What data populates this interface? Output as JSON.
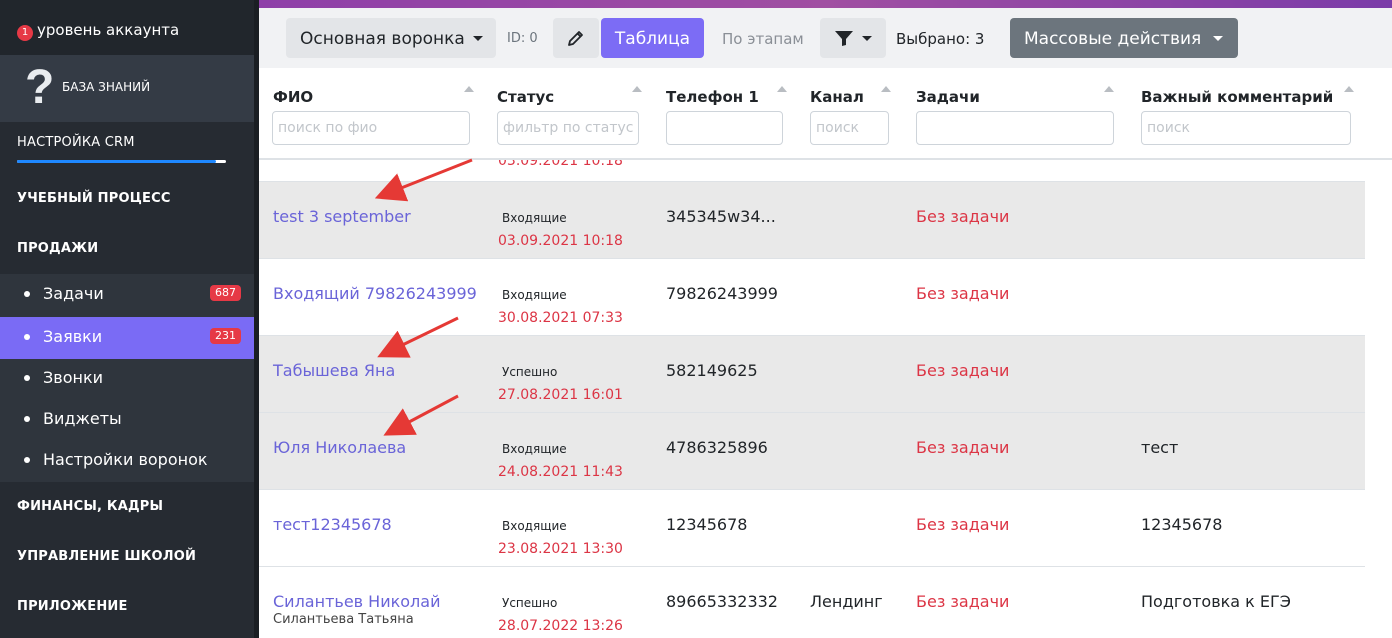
{
  "sidebar": {
    "account": {
      "count": "1",
      "label": "уровень аккаунта"
    },
    "knowledge_base": {
      "icon_glyph": "?",
      "label": "БАЗА ЗНАНИЙ"
    },
    "crm_setup": {
      "label": "НАСТРОЙКА CRM",
      "progress": 0.95
    },
    "sections": [
      {
        "label": "УЧЕБНЫЙ ПРОЦЕСС"
      },
      {
        "label": "ПРОДАЖИ"
      },
      {
        "label": "ФИНАНСЫ, КАДРЫ"
      },
      {
        "label": "УПРАВЛЕНИЕ ШКОЛОЙ"
      },
      {
        "label": "ПРИЛОЖЕНИЕ"
      }
    ],
    "sales_items": [
      {
        "label": "Задачи",
        "badge": "687"
      },
      {
        "label": "Заявки",
        "badge": "231",
        "active": true
      },
      {
        "label": "Звонки"
      },
      {
        "label": "Виджеты"
      },
      {
        "label": "Настройки воронок"
      }
    ]
  },
  "colors": {
    "accent": "#7c6cf5",
    "danger": "#dc3545",
    "link": "#6a64d8",
    "sidebar_bg": "#262b32"
  },
  "toolbar": {
    "funnel_select": "Основная воронка",
    "id_label": "ID: 0",
    "table_button": "Таблица",
    "stages_label": "По этапам",
    "selected_label": "Выбрано: 3",
    "mass_actions": "Массовые действия"
  },
  "table": {
    "columns": [
      {
        "label": "ФИО",
        "placeholder": "поиск по фио"
      },
      {
        "label": "Статус",
        "placeholder": "фильтр по статусу"
      },
      {
        "label": "Телефон 1",
        "placeholder": ""
      },
      {
        "label": "Канал",
        "placeholder": "поиск"
      },
      {
        "label": "Задачи",
        "placeholder": ""
      },
      {
        "label": "Важный комментарий",
        "placeholder": "поиск"
      }
    ],
    "rows": [
      {
        "name": "test 3 september",
        "sub": "",
        "status": "Входящие",
        "date": "03.09.2021 10:18",
        "phone": "345345w34...",
        "channel": "",
        "task": "Без задачи",
        "comment": ""
      },
      {
        "name": "Входящий 79826243999",
        "sub": "",
        "status": "Входящие",
        "date": "30.08.2021 07:33",
        "phone": "79826243999",
        "channel": "",
        "task": "Без задачи",
        "comment": ""
      },
      {
        "name": "Табышева Яна",
        "sub": "",
        "status": "Успешно",
        "date": "27.08.2021 16:01",
        "phone": "582149625",
        "channel": "",
        "task": "Без задачи",
        "comment": ""
      },
      {
        "name": "Юля Николаева",
        "sub": "",
        "status": "Входящие",
        "date": "24.08.2021 11:43",
        "phone": "4786325896",
        "channel": "",
        "task": "Без задачи",
        "comment": "тест"
      },
      {
        "name": "тест12345678",
        "sub": "",
        "status": "Входящие",
        "date": "23.08.2021 13:30",
        "phone": "12345678",
        "channel": "",
        "task": "Без задачи",
        "comment": "12345678"
      },
      {
        "name": "Силантьев Николай",
        "sub": "Силантьева Татьяна",
        "status": "Успешно",
        "date": "28.07.2022 13:26",
        "phone": "89665332332",
        "channel": "Лендинг",
        "task": "Без задачи",
        "comment": "Подготовка к ЕГЭ"
      }
    ]
  }
}
